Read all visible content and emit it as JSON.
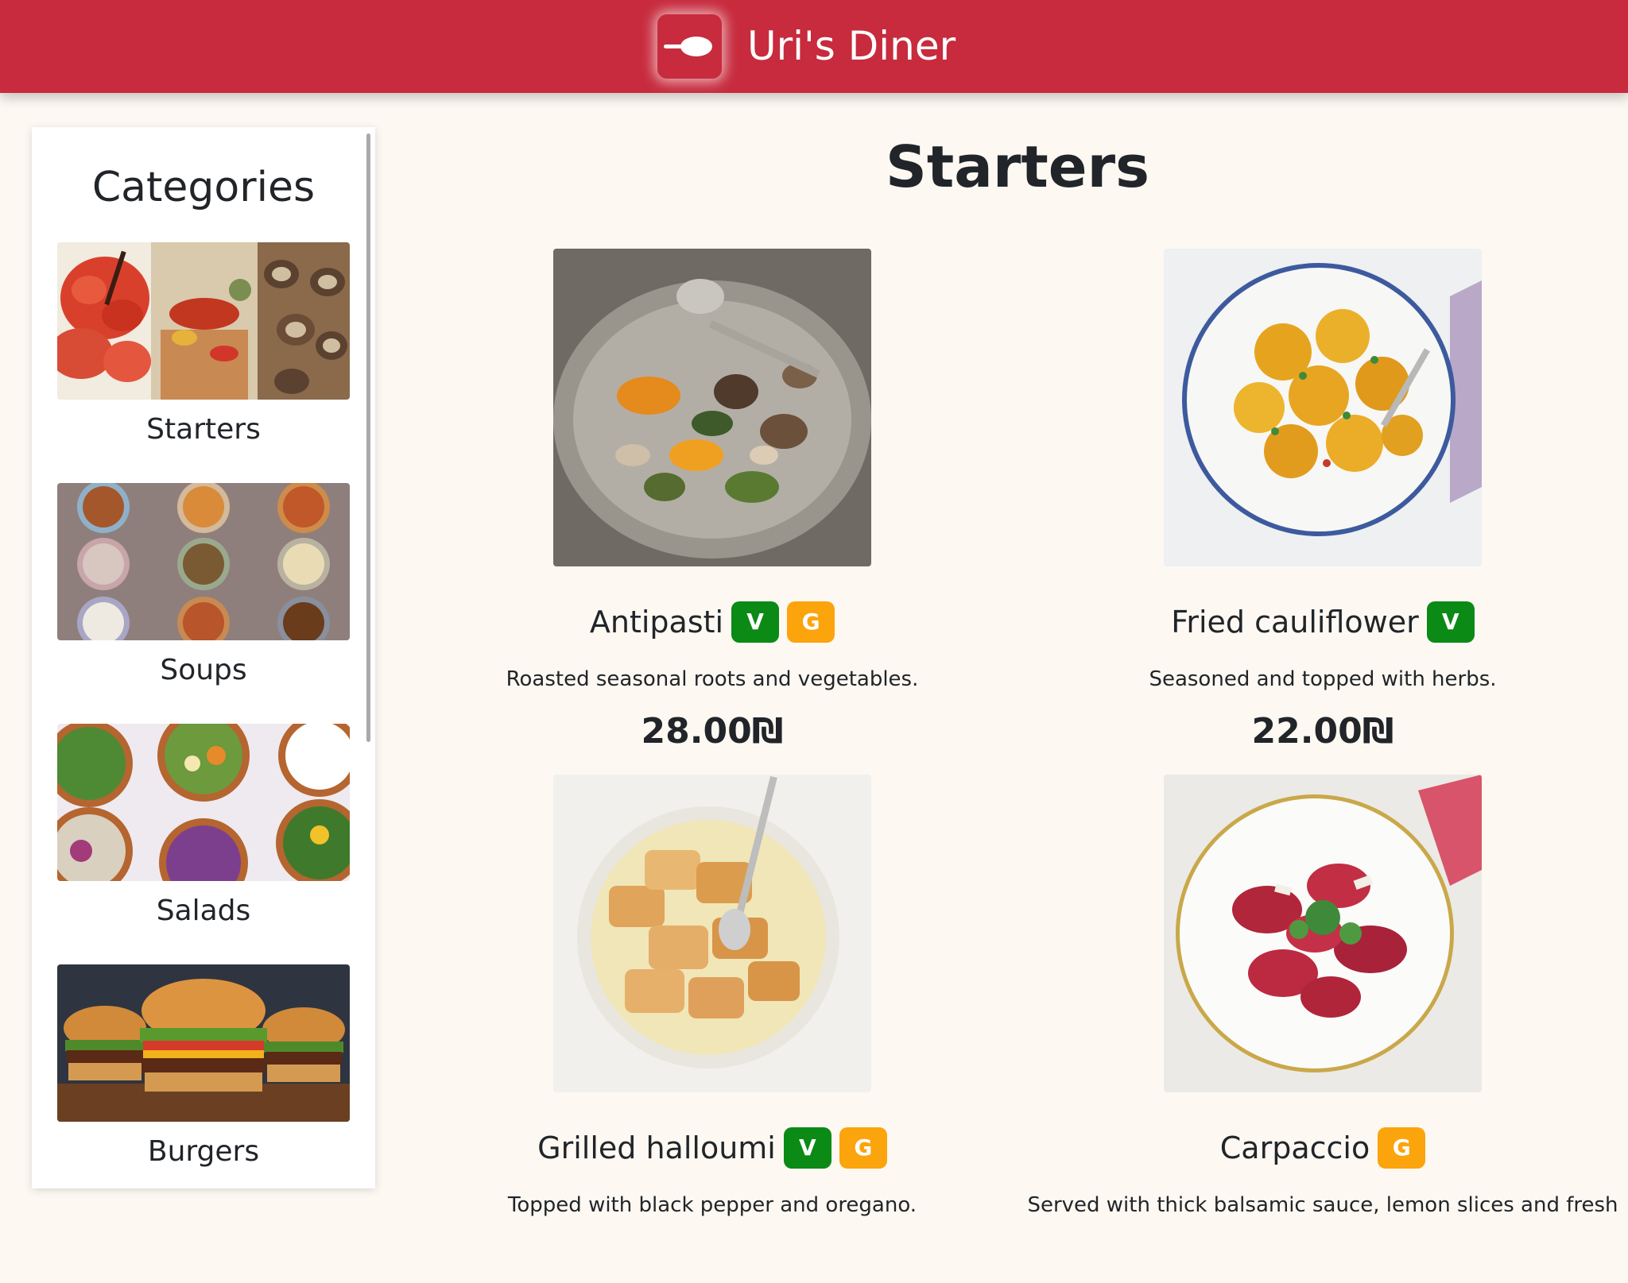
{
  "header": {
    "brand": "Uri's Diner",
    "logo_icon": "spoon-icon",
    "background_color": "#c72b3d"
  },
  "sidebar": {
    "title": "Categories",
    "items": [
      {
        "label": "Starters",
        "image": "starters-photo"
      },
      {
        "label": "Soups",
        "image": "soups-photo"
      },
      {
        "label": "Salads",
        "image": "salads-photo"
      },
      {
        "label": "Burgers",
        "image": "burgers-photo"
      }
    ]
  },
  "main": {
    "title": "Starters",
    "items": [
      {
        "name": "Antipasti",
        "tags": [
          "V",
          "G"
        ],
        "description": "Roasted seasonal roots and vegetables.",
        "price": "28.00₪"
      },
      {
        "name": "Fried cauliflower",
        "tags": [
          "V"
        ],
        "description": "Seasoned and topped with herbs.",
        "price": "22.00₪"
      },
      {
        "name": "Grilled halloumi",
        "tags": [
          "V",
          "G"
        ],
        "description": "Topped with black pepper and oregano.",
        "price": ""
      },
      {
        "name": "Carpaccio",
        "tags": [
          "G"
        ],
        "description": "Served with thick balsamic sauce, lemon slices and fresh",
        "price": ""
      }
    ]
  },
  "tag_colors": {
    "V": "#0b8a15",
    "G": "#fba40c"
  },
  "page_background": "#fdf8f2"
}
